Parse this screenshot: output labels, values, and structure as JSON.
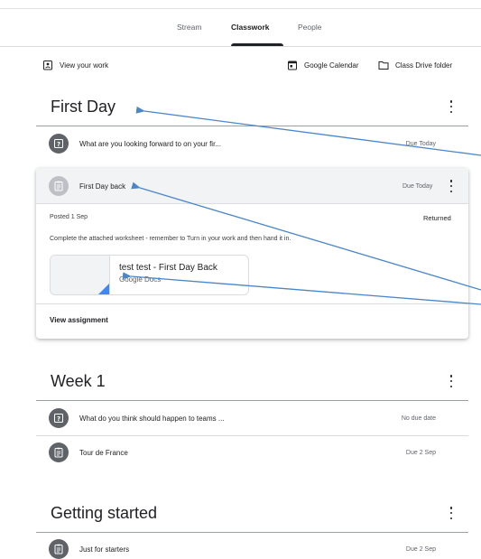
{
  "tabs": [
    {
      "label": "Stream",
      "active": false
    },
    {
      "label": "Classwork",
      "active": true
    },
    {
      "label": "People",
      "active": false
    }
  ],
  "toolbar": {
    "view_work": "View your work",
    "calendar": "Google Calendar",
    "drive": "Class Drive folder"
  },
  "sections": {
    "first_day": {
      "title": "First Day",
      "rows": [
        {
          "title": "What are you looking forward to on your fir...",
          "due": "Due Today",
          "icon": "question-icon"
        }
      ],
      "card": {
        "title": "First Day back",
        "due": "Due Today",
        "posted": "Posted 1 Sep",
        "status": "Returned",
        "instructions": "Complete the attached worksheet - remember to Turn in your work and then hand it in.",
        "attachment": {
          "title": "test test - First Day Back",
          "subtitle": "Google Docs"
        },
        "view_label": "View assignment"
      }
    },
    "week1": {
      "title": "Week 1",
      "rows": [
        {
          "title": "What do you think should happen to teams ...",
          "due": "No due date",
          "icon": "question-icon"
        },
        {
          "title": "Tour de France",
          "due": "Due 2 Sep",
          "icon": "assignment-icon"
        }
      ]
    },
    "getting_started": {
      "title": "Getting started",
      "rows": [
        {
          "title": "Just for starters",
          "due": "Due 2 Sep",
          "icon": "assignment-icon"
        }
      ]
    }
  },
  "colors": {
    "icon_dark": "#5f6368",
    "icon_light": "#bdc1c6",
    "annotation_arrow": "#4a86c8",
    "doc_blue": "#4285f4"
  }
}
